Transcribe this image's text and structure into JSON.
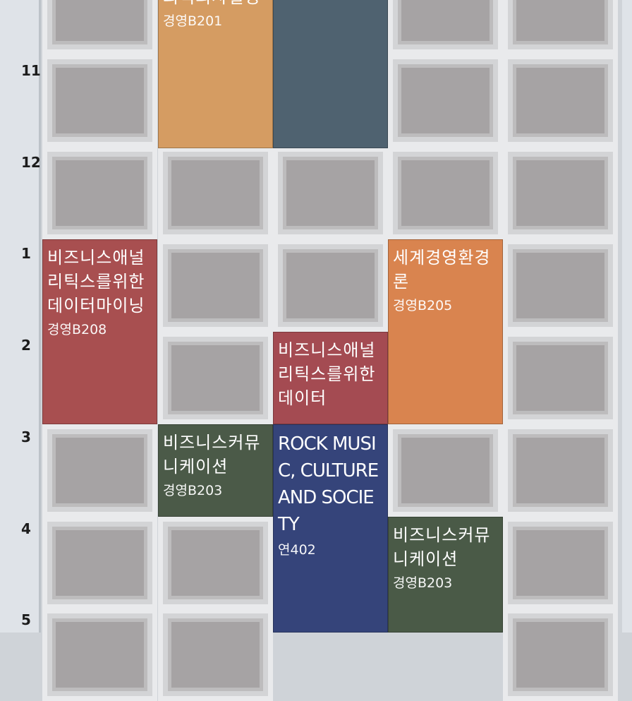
{
  "hours": [
    "11",
    "12",
    "1",
    "2",
    "3",
    "4",
    "5"
  ],
  "colors": {
    "orange_top": "#d59c62",
    "slate": "#4f6270",
    "red": "#a84f50",
    "orange": "#d9844f",
    "wine": "#a44b52",
    "green": "#4b5a48",
    "navy": "#35447a"
  },
  "courses": [
    {
      "name": "최적의사결정",
      "room": "경영B201",
      "color": "orange_top"
    },
    {
      "name": "",
      "room": "",
      "color": "slate"
    },
    {
      "name": "비즈니스애널리틱스를위한데이터마이닝",
      "room": "경영B208",
      "color": "red"
    },
    {
      "name": "세계경영환경론",
      "room": "경영B205",
      "color": "orange"
    },
    {
      "name": "비즈니스애널리틱스를위한데이터",
      "room": "",
      "color": "wine"
    },
    {
      "name": "비즈니스커뮤니케이션",
      "room": "경영B203",
      "color": "green"
    },
    {
      "name": "ROCK MUSIC, CULTURE AND SOCIETY",
      "room": "연402",
      "color": "navy"
    },
    {
      "name": "비즈니스커뮤니케이션",
      "room": "경영B203",
      "color": "green"
    }
  ]
}
